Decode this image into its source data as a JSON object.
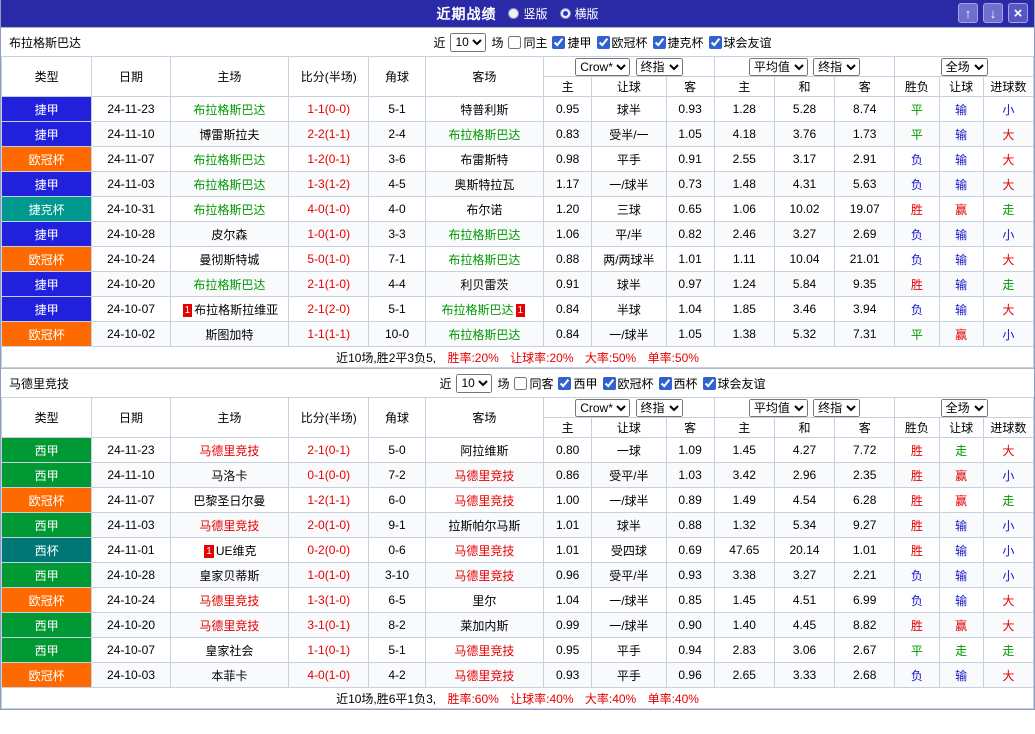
{
  "titlebar": {
    "title": "近期战绩",
    "radios": [
      {
        "label": "竖版",
        "selected": false
      },
      {
        "label": "横版",
        "selected": true
      }
    ],
    "buttons": {
      "up": "↑",
      "down": "↓",
      "close": "×"
    }
  },
  "colors": {
    "league": {
      "捷甲": "#2020dd",
      "欧冠杯": "#ff6a00",
      "捷克杯": "#00998f",
      "西甲": "#009933",
      "西杯": "#007777"
    },
    "verdict": {
      "胜": "#e60000",
      "平": "#009900",
      "负": "#1414cc",
      "赢": "#e60000",
      "走": "#009900",
      "输": "#1414cc",
      "大": "#e60000",
      "小": "#1414cc"
    }
  },
  "header_labels": {
    "type": "类型",
    "date": "日期",
    "home": "主场",
    "score": "比分(半场)",
    "corner": "角球",
    "away": "客场",
    "selects": {
      "odds_source": "Crow*",
      "odds_time1": "终指",
      "avg": "平均值",
      "odds_time2": "终指",
      "scope": "全场"
    },
    "sub": [
      "主",
      "让球",
      "客",
      "主",
      "和",
      "客",
      "胜负",
      "让球",
      "进球数"
    ]
  },
  "tables": [
    {
      "team": "布拉格斯巴达",
      "focus_color": "#009900",
      "filter": {
        "near": "近",
        "count": "10",
        "matches": "场",
        "same": "同主",
        "same_checked": false,
        "leagues": [
          {
            "label": "捷甲",
            "checked": true
          },
          {
            "label": "欧冠杯",
            "checked": true
          },
          {
            "label": "捷克杯",
            "checked": true
          },
          {
            "label": "球会友谊",
            "checked": true
          }
        ]
      },
      "rows": [
        {
          "league": "捷甲",
          "date": "24-11-23",
          "home": "布拉格斯巴达",
          "home_focus": true,
          "score": "1-1(0-0)",
          "corner": "5-1",
          "away": "特普利斯",
          "odds": [
            "0.95",
            "球半",
            "0.93",
            "1.28",
            "5.28",
            "8.74"
          ],
          "result": "平",
          "handicap": "输",
          "goals": "小"
        },
        {
          "league": "捷甲",
          "date": "24-11-10",
          "home": "博雷斯拉夫",
          "score": "2-2(1-1)",
          "corner": "2-4",
          "away": "布拉格斯巴达",
          "away_focus": true,
          "odds": [
            "0.83",
            "受半/一",
            "1.05",
            "4.18",
            "3.76",
            "1.73"
          ],
          "result": "平",
          "handicap": "输",
          "goals": "大"
        },
        {
          "league": "欧冠杯",
          "date": "24-11-07",
          "home": "布拉格斯巴达",
          "home_focus": true,
          "score": "1-2(0-1)",
          "corner": "3-6",
          "away": "布雷斯特",
          "odds": [
            "0.98",
            "平手",
            "0.91",
            "2.55",
            "3.17",
            "2.91"
          ],
          "result": "负",
          "handicap": "输",
          "goals": "大"
        },
        {
          "league": "捷甲",
          "date": "24-11-03",
          "home": "布拉格斯巴达",
          "home_focus": true,
          "score": "1-3(1-2)",
          "corner": "4-5",
          "away": "奥斯特拉瓦",
          "odds": [
            "1.17",
            "一/球半",
            "0.73",
            "1.48",
            "4.31",
            "5.63"
          ],
          "result": "负",
          "handicap": "输",
          "goals": "大"
        },
        {
          "league": "捷克杯",
          "date": "24-10-31",
          "home": "布拉格斯巴达",
          "home_focus": true,
          "score": "4-0(1-0)",
          "corner": "4-0",
          "away": "布尔诺",
          "odds": [
            "1.20",
            "三球",
            "0.65",
            "1.06",
            "10.02",
            "19.07"
          ],
          "result": "胜",
          "handicap": "赢",
          "goals": "走"
        },
        {
          "league": "捷甲",
          "date": "24-10-28",
          "home": "皮尔森",
          "score": "1-0(1-0)",
          "corner": "3-3",
          "away": "布拉格斯巴达",
          "away_focus": true,
          "odds": [
            "1.06",
            "平/半",
            "0.82",
            "2.46",
            "3.27",
            "2.69"
          ],
          "result": "负",
          "handicap": "输",
          "goals": "小"
        },
        {
          "league": "欧冠杯",
          "date": "24-10-24",
          "home": "曼彻斯特城",
          "score": "5-0(1-0)",
          "corner": "7-1",
          "away": "布拉格斯巴达",
          "away_focus": true,
          "odds": [
            "0.88",
            "两/两球半",
            "1.01",
            "1.11",
            "10.04",
            "21.01"
          ],
          "result": "负",
          "handicap": "输",
          "goals": "大"
        },
        {
          "league": "捷甲",
          "date": "24-10-20",
          "home": "布拉格斯巴达",
          "home_focus": true,
          "score": "2-1(1-0)",
          "corner": "4-4",
          "away": "利贝雷茨",
          "odds": [
            "0.91",
            "球半",
            "0.97",
            "1.24",
            "5.84",
            "9.35"
          ],
          "result": "胜",
          "handicap": "输",
          "goals": "走"
        },
        {
          "league": "捷甲",
          "date": "24-10-07",
          "home": "布拉格斯拉维亚",
          "home_badge": "1",
          "score": "2-1(2-0)",
          "corner": "5-1",
          "away": "布拉格斯巴达",
          "away_focus": true,
          "away_badge": "1",
          "odds": [
            "0.84",
            "半球",
            "1.04",
            "1.85",
            "3.46",
            "3.94"
          ],
          "result": "负",
          "handicap": "输",
          "goals": "大"
        },
        {
          "league": "欧冠杯",
          "date": "24-10-02",
          "home": "斯图加特",
          "score": "1-1(1-1)",
          "corner": "10-0",
          "away": "布拉格斯巴达",
          "away_focus": true,
          "odds": [
            "0.84",
            "一/球半",
            "1.05",
            "1.38",
            "5.32",
            "7.31"
          ],
          "result": "平",
          "handicap": "赢",
          "goals": "小"
        }
      ],
      "footer": {
        "summary": "近10场,胜2平3负5,",
        "stats": [
          "胜率:20%",
          "让球率:20%",
          "大率:50%",
          "单率:50%"
        ]
      }
    },
    {
      "team": "马德里竞技",
      "focus_color": "#e60000",
      "filter": {
        "near": "近",
        "count": "10",
        "matches": "场",
        "same": "同客",
        "same_checked": false,
        "leagues": [
          {
            "label": "西甲",
            "checked": true
          },
          {
            "label": "欧冠杯",
            "checked": true
          },
          {
            "label": "西杯",
            "checked": true
          },
          {
            "label": "球会友谊",
            "checked": true
          }
        ]
      },
      "rows": [
        {
          "league": "西甲",
          "date": "24-11-23",
          "home": "马德里竞技",
          "home_focus": true,
          "score": "2-1(0-1)",
          "corner": "5-0",
          "away": "阿拉维斯",
          "odds": [
            "0.80",
            "一球",
            "1.09",
            "1.45",
            "4.27",
            "7.72"
          ],
          "result": "胜",
          "handicap": "走",
          "goals": "大"
        },
        {
          "league": "西甲",
          "date": "24-11-10",
          "home": "马洛卡",
          "score": "0-1(0-0)",
          "corner": "7-2",
          "away": "马德里竞技",
          "away_focus": true,
          "odds": [
            "0.86",
            "受平/半",
            "1.03",
            "3.42",
            "2.96",
            "2.35"
          ],
          "result": "胜",
          "handicap": "赢",
          "goals": "小"
        },
        {
          "league": "欧冠杯",
          "date": "24-11-07",
          "home": "巴黎圣日尔曼",
          "score": "1-2(1-1)",
          "corner": "6-0",
          "away": "马德里竞技",
          "away_focus": true,
          "odds": [
            "1.00",
            "一/球半",
            "0.89",
            "1.49",
            "4.54",
            "6.28"
          ],
          "result": "胜",
          "handicap": "赢",
          "goals": "走"
        },
        {
          "league": "西甲",
          "date": "24-11-03",
          "home": "马德里竞技",
          "home_focus": true,
          "score": "2-0(1-0)",
          "corner": "9-1",
          "away": "拉斯帕尔马斯",
          "odds": [
            "1.01",
            "球半",
            "0.88",
            "1.32",
            "5.34",
            "9.27"
          ],
          "result": "胜",
          "handicap": "输",
          "goals": "小"
        },
        {
          "league": "西杯",
          "date": "24-11-01",
          "home": "UE维克",
          "home_badge": "1",
          "score": "0-2(0-0)",
          "corner": "0-6",
          "away": "马德里竞技",
          "away_focus": true,
          "odds": [
            "1.01",
            "受四球",
            "0.69",
            "47.65",
            "20.14",
            "1.01"
          ],
          "result": "胜",
          "handicap": "输",
          "goals": "小"
        },
        {
          "league": "西甲",
          "date": "24-10-28",
          "home": "皇家贝蒂斯",
          "score": "1-0(1-0)",
          "corner": "3-10",
          "away": "马德里竞技",
          "away_focus": true,
          "odds": [
            "0.96",
            "受平/半",
            "0.93",
            "3.38",
            "3.27",
            "2.21"
          ],
          "result": "负",
          "handicap": "输",
          "goals": "小"
        },
        {
          "league": "欧冠杯",
          "date": "24-10-24",
          "home": "马德里竞技",
          "home_focus": true,
          "score": "1-3(1-0)",
          "corner": "6-5",
          "away": "里尔",
          "odds": [
            "1.04",
            "一/球半",
            "0.85",
            "1.45",
            "4.51",
            "6.99"
          ],
          "result": "负",
          "handicap": "输",
          "goals": "大"
        },
        {
          "league": "西甲",
          "date": "24-10-20",
          "home": "马德里竞技",
          "home_focus": true,
          "score": "3-1(0-1)",
          "corner": "8-2",
          "away": "莱加内斯",
          "odds": [
            "0.99",
            "一/球半",
            "0.90",
            "1.40",
            "4.45",
            "8.82"
          ],
          "result": "胜",
          "handicap": "赢",
          "goals": "大"
        },
        {
          "league": "西甲",
          "date": "24-10-07",
          "home": "皇家社会",
          "score": "1-1(0-1)",
          "corner": "5-1",
          "away": "马德里竞技",
          "away_focus": true,
          "odds": [
            "0.95",
            "平手",
            "0.94",
            "2.83",
            "3.06",
            "2.67"
          ],
          "result": "平",
          "handicap": "走",
          "goals": "走"
        },
        {
          "league": "欧冠杯",
          "date": "24-10-03",
          "home": "本菲卡",
          "score": "4-0(1-0)",
          "corner": "4-2",
          "away": "马德里竞技",
          "away_focus": true,
          "odds": [
            "0.93",
            "平手",
            "0.96",
            "2.65",
            "3.33",
            "2.68"
          ],
          "result": "负",
          "handicap": "输",
          "goals": "大"
        }
      ],
      "footer": {
        "summary": "近10场,胜6平1负3,",
        "stats": [
          "胜率:60%",
          "让球率:40%",
          "大率:40%",
          "单率:40%"
        ]
      }
    }
  ]
}
